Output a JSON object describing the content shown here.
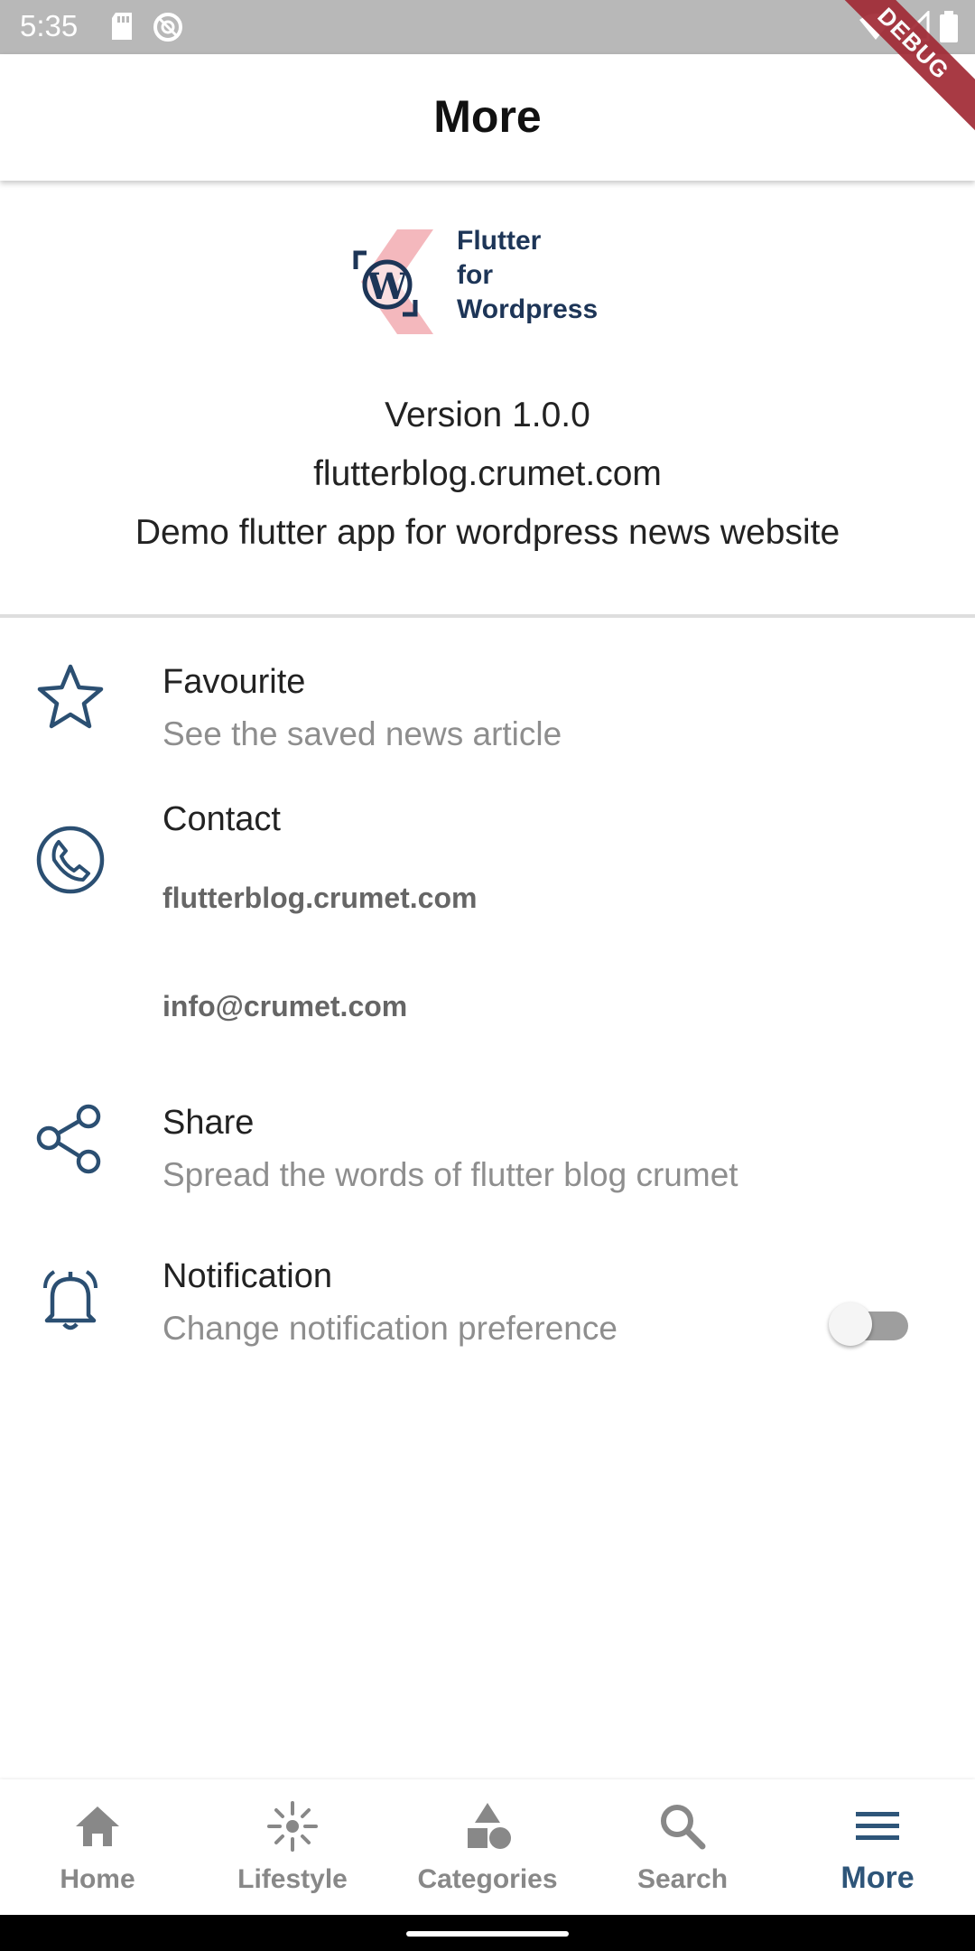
{
  "status_bar": {
    "time": "5:35"
  },
  "debug_banner": "DEBUG",
  "app_bar": {
    "title": "More"
  },
  "logo": {
    "line1": "Flutter",
    "line2": "for",
    "line3": "Wordpress"
  },
  "app_info": {
    "version": "Version 1.0.0",
    "website": "flutterblog.crumet.com",
    "description": "Demo flutter app for wordpress news website"
  },
  "menu": {
    "favourite": {
      "title": "Favourite",
      "subtitle": "See the saved news article",
      "icon": "star-icon"
    },
    "contact": {
      "title": "Contact",
      "website": "flutterblog.crumet.com",
      "email": "info@crumet.com",
      "icon": "phone-icon"
    },
    "share": {
      "title": "Share",
      "subtitle": "Spread the words of flutter blog crumet",
      "icon": "share-icon"
    },
    "notification": {
      "title": "Notification",
      "subtitle": "Change notification preference",
      "icon": "bell-icon",
      "enabled": false
    }
  },
  "bottom_nav": {
    "items": [
      {
        "label": "Home",
        "icon": "home-icon"
      },
      {
        "label": "Lifestyle",
        "icon": "lifestyle-icon"
      },
      {
        "label": "Categories",
        "icon": "categories-icon"
      },
      {
        "label": "Search",
        "icon": "search-icon"
      },
      {
        "label": "More",
        "icon": "menu-icon"
      }
    ],
    "active_index": 4
  },
  "colors": {
    "accent": "#2e5579",
    "icon": "#2b4f72",
    "logo_text": "#1d3557",
    "logo_pink": "#f4b8bd"
  }
}
